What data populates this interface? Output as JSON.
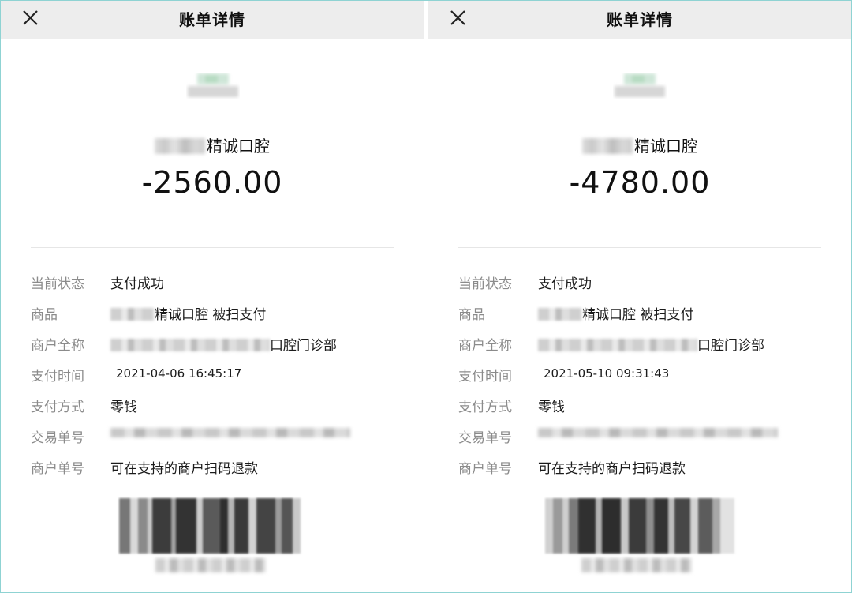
{
  "panels": [
    {
      "header": {
        "title": "账单详情"
      },
      "merchant_suffix": "精诚口腔",
      "amount": "-2560.00",
      "details": [
        {
          "label": "当前状态",
          "value": "支付成功"
        },
        {
          "label": "商品",
          "value": "精诚口腔 被扫支付"
        },
        {
          "label": "商户全称",
          "value": "口腔门诊部"
        },
        {
          "label": "支付时间",
          "value": "2021-04-06 16:45:17"
        },
        {
          "label": "支付方式",
          "value": "零钱"
        },
        {
          "label": "交易单号",
          "value": ""
        },
        {
          "label": "商户单号",
          "value": "可在支持的商户扫码退款"
        }
      ]
    },
    {
      "header": {
        "title": "账单详情"
      },
      "merchant_suffix": "精诚口腔",
      "amount": "-4780.00",
      "details": [
        {
          "label": "当前状态",
          "value": "支付成功"
        },
        {
          "label": "商品",
          "value": "精诚口腔 被扫支付"
        },
        {
          "label": "商户全称",
          "value": "口腔门诊部"
        },
        {
          "label": "支付时间",
          "value": "2021-05-10 09:31:43"
        },
        {
          "label": "支付方式",
          "value": "零钱"
        },
        {
          "label": "交易单号",
          "value": ""
        },
        {
          "label": "商户单号",
          "value": "可在支持的商户扫码退款"
        }
      ]
    }
  ],
  "icons": {
    "close": "close-icon",
    "merchant_logo": "merchant-logo-icon",
    "barcode": "barcode-icon"
  },
  "colors": {
    "header_bg": "#ededed",
    "label": "#8b8b8b",
    "text": "#1b1b1b",
    "divider": "#e6e6e6",
    "frame": "#8fd3d3"
  }
}
